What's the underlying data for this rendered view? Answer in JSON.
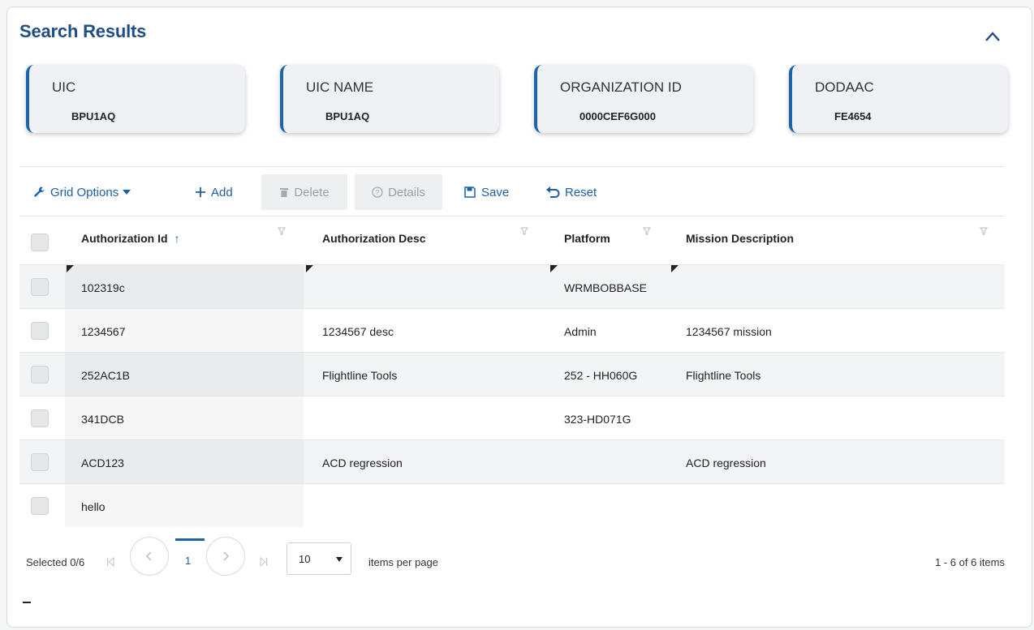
{
  "title": "Search Results",
  "cards": [
    {
      "label": "UIC",
      "value": "BPU1AQ"
    },
    {
      "label": "UIC NAME",
      "value": "BPU1AQ"
    },
    {
      "label": "ORGANIZATION ID",
      "value": "0000CEF6G000"
    },
    {
      "label": "DODAAC",
      "value": "FE4654"
    }
  ],
  "toolbar": {
    "grid_options": "Grid Options",
    "add": "Add",
    "delete": "Delete",
    "details": "Details",
    "save": "Save",
    "reset": "Reset"
  },
  "columns": {
    "auth_id": "Authorization Id",
    "sort_indicator": "↑",
    "auth_desc": "Authorization Desc",
    "platform": "Platform",
    "mission": "Mission Description"
  },
  "rows": [
    {
      "auth_id": "102319c",
      "auth_desc": "",
      "platform": "WRMBOBBASE",
      "mission": ""
    },
    {
      "auth_id": "1234567",
      "auth_desc": "1234567 desc",
      "platform": "Admin",
      "mission": "1234567 mission"
    },
    {
      "auth_id": "252AC1B",
      "auth_desc": "Flightline Tools",
      "platform": "252 - HH060G",
      "mission": "Flightline Tools"
    },
    {
      "auth_id": "341DCB",
      "auth_desc": "",
      "platform": "323-HD071G",
      "mission": ""
    },
    {
      "auth_id": "ACD123",
      "auth_desc": "ACD regression",
      "platform": "",
      "mission": "ACD regression"
    },
    {
      "auth_id": "hello",
      "auth_desc": "",
      "platform": "",
      "mission": ""
    }
  ],
  "pager": {
    "selected": "Selected 0/6",
    "current_page": "1",
    "page_size": "10",
    "items_per_page": "items per page",
    "range": "1 - 6 of 6 items"
  },
  "icons": {
    "collapse": "chevron-up-icon",
    "grid_options": "wrench-icon",
    "add": "plus-icon",
    "delete": "trash-icon",
    "details": "help-circle-icon",
    "save": "floppy-disk-icon",
    "reset": "undo-icon",
    "filter": "filter-icon"
  },
  "colors": {
    "accent": "#1f4e84",
    "link": "#1d5fa6",
    "card_border": "#1d64a9"
  }
}
